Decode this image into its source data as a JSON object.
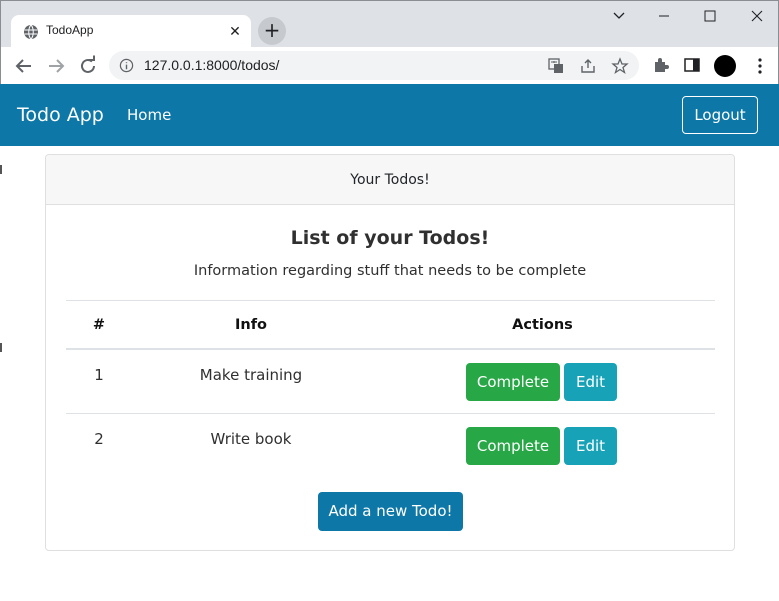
{
  "browser": {
    "tab_title": "TodoApp",
    "tab_close_glyph": "✕",
    "newtab_glyph": "+",
    "url": "127.0.0.1:8000/todos/"
  },
  "navbar": {
    "brand": "Todo App",
    "home_link": "Home",
    "logout_label": "Logout",
    "bg_color": "#0d77a8"
  },
  "card": {
    "header": "Your Todos!",
    "title": "List of your Todos!",
    "subtitle": "Information regarding stuff that needs to be complete"
  },
  "table": {
    "columns": [
      "#",
      "Info",
      "Actions"
    ],
    "rows": [
      {
        "num": "1",
        "info": "Make training",
        "complete_label": "Complete",
        "edit_label": "Edit"
      },
      {
        "num": "2",
        "info": "Write book",
        "complete_label": "Complete",
        "edit_label": "Edit"
      }
    ]
  },
  "add_button_label": "Add a new Todo!",
  "colors": {
    "complete": "#27a745",
    "edit": "#17a2b8",
    "primary": "#0d77a8"
  }
}
